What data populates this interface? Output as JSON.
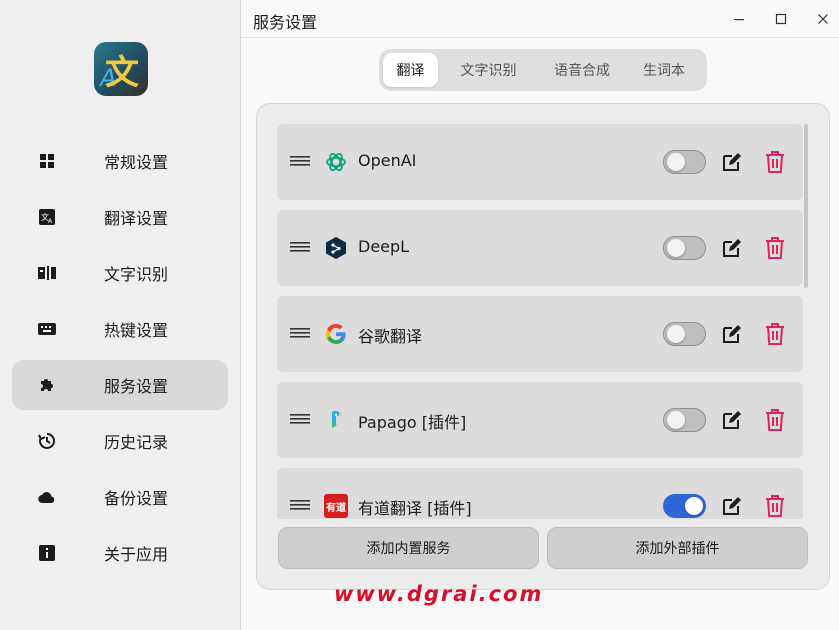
{
  "app": {
    "title": "服务设置"
  },
  "sidebar": {
    "items": [
      {
        "label": "常规设置",
        "icon": "grid-icon",
        "active": false
      },
      {
        "label": "翻译设置",
        "icon": "translate-icon",
        "active": false
      },
      {
        "label": "文字识别",
        "icon": "ocr-icon",
        "active": false
      },
      {
        "label": "热键设置",
        "icon": "keyboard-icon",
        "active": false
      },
      {
        "label": "服务设置",
        "icon": "puzzle-icon",
        "active": true
      },
      {
        "label": "历史记录",
        "icon": "history-icon",
        "active": false
      },
      {
        "label": "备份设置",
        "icon": "cloud-icon",
        "active": false
      },
      {
        "label": "关于应用",
        "icon": "info-icon",
        "active": false
      }
    ]
  },
  "tabs": [
    {
      "label": "翻译",
      "active": true
    },
    {
      "label": "文字识别",
      "active": false
    },
    {
      "label": "语音合成",
      "active": false
    },
    {
      "label": "生词本",
      "active": false
    }
  ],
  "services": [
    {
      "name": "OpenAI",
      "logo": "openai-icon",
      "enabled": false
    },
    {
      "name": "DeepL",
      "logo": "deepl-icon",
      "enabled": false
    },
    {
      "name": "谷歌翻译",
      "logo": "google-icon",
      "enabled": false
    },
    {
      "name": "Papago [插件]",
      "logo": "papago-icon",
      "enabled": false
    },
    {
      "name": "有道翻译 [插件]",
      "logo": "youdao-icon",
      "logo_text": "有道",
      "enabled": true
    }
  ],
  "buttons": {
    "add_builtin": "添加内置服务",
    "add_external": "添加外部插件"
  },
  "watermark": "www.dgrai.com",
  "colors": {
    "accent": "#2f66d6",
    "delete": "#e0245e",
    "active_nav": "#d8d8d8"
  }
}
